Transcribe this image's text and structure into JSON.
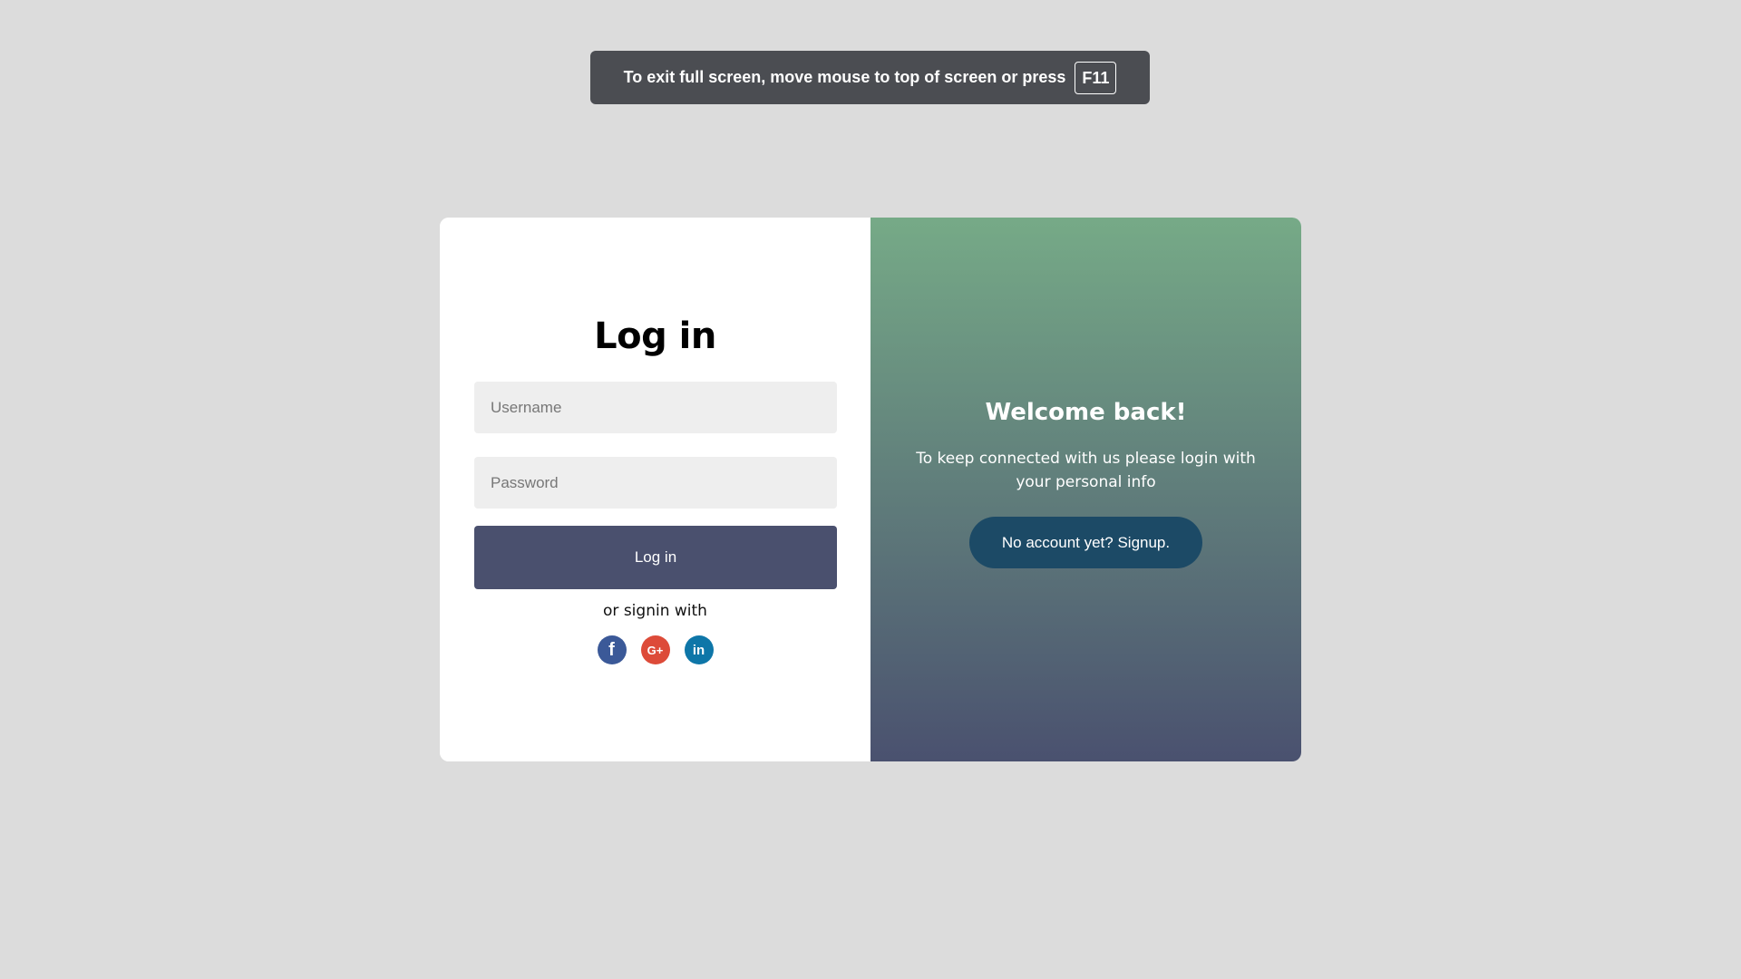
{
  "fullscreen_notice": {
    "message": "To exit full screen, move mouse to top of screen or press",
    "key": "F11"
  },
  "login": {
    "title": "Log in",
    "username_placeholder": "Username",
    "password_placeholder": "Password",
    "submit_label": "Log in",
    "alt_signin_text": "or signin with",
    "socials": [
      {
        "icon": "facebook-icon",
        "glyph": "f",
        "color": "#3b5998"
      },
      {
        "icon": "google-plus-icon",
        "glyph": "G+",
        "color": "#dd4b39"
      },
      {
        "icon": "linkedin-icon",
        "glyph": "in",
        "color": "#0e76a8"
      }
    ]
  },
  "welcome": {
    "title": "Welcome back!",
    "subtitle": "To keep connected with us please login with your personal info",
    "signup_label": "No account yet? Signup."
  },
  "colors": {
    "background": "#dcdcdc",
    "login_button": "#4a506e",
    "signup_button": "#1c4a66",
    "gradient_top": "#76aa87",
    "gradient_bottom": "#4a516f"
  }
}
